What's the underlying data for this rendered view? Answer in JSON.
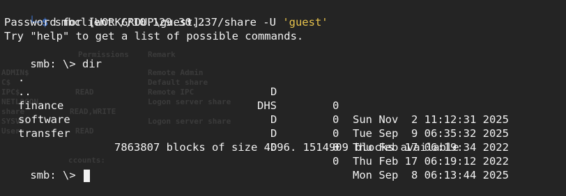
{
  "window": {
    "background": "#242424",
    "prompt_color": "#3c6cc0",
    "string_color": "#e8c34c",
    "text_color": "#f2f2f2"
  },
  "command": {
    "tree_prefix": "└─",
    "dollar": "$",
    "text": "smbclient //10.129.30.237/share -U ",
    "arg": "'guest'"
  },
  "output": {
    "password_prompt": "Password for [WORKGROUP\\guest]:",
    "help_hint": "Try \"help\" to get a list of possible commands."
  },
  "smb_prompt": {
    "label": "smb: \\>",
    "command": "dir"
  },
  "listing": [
    {
      "name": ".",
      "attr": "D",
      "size": "0",
      "date": "Sun Nov  2 11:12:31 2025"
    },
    {
      "name": "..",
      "attr": "DHS",
      "size": "0",
      "date": "Tue Sep  9 06:35:32 2025"
    },
    {
      "name": "finance",
      "attr": "D",
      "size": "0",
      "date": "Thu Feb 17 06:19:34 2022"
    },
    {
      "name": "software",
      "attr": "D",
      "size": "0",
      "date": "Thu Feb 17 06:19:12 2022"
    },
    {
      "name": "transfer",
      "attr": "D",
      "size": "0",
      "date": "Mon Sep  8 06:13:44 2025"
    }
  ],
  "summary": "7863807 blocks of size 4096. 1514909 blocks available",
  "final_prompt": {
    "label": "smb: \\>"
  },
  "background_ghost": {
    "permissions_header": "Permissions",
    "remark_header": "Remark",
    "rows": [
      {
        "share": "ADMIN$",
        "perm": "",
        "remark": "Remote Admin"
      },
      {
        "share": "C$",
        "perm": "",
        "remark": "Default share"
      },
      {
        "share": "IPC$",
        "perm": "READ",
        "remark": "Remote IPC"
      },
      {
        "share": "NETLOGON",
        "perm": "",
        "remark": "Logon server share"
      },
      {
        "share": "share",
        "perm": "READ,WRITE",
        "remark": ""
      },
      {
        "share": "SYSVOL",
        "perm": "",
        "remark": "Logon server share"
      },
      {
        "share": "Users",
        "perm": "READ",
        "remark": ""
      }
    ],
    "accounts": "ccounts:"
  }
}
